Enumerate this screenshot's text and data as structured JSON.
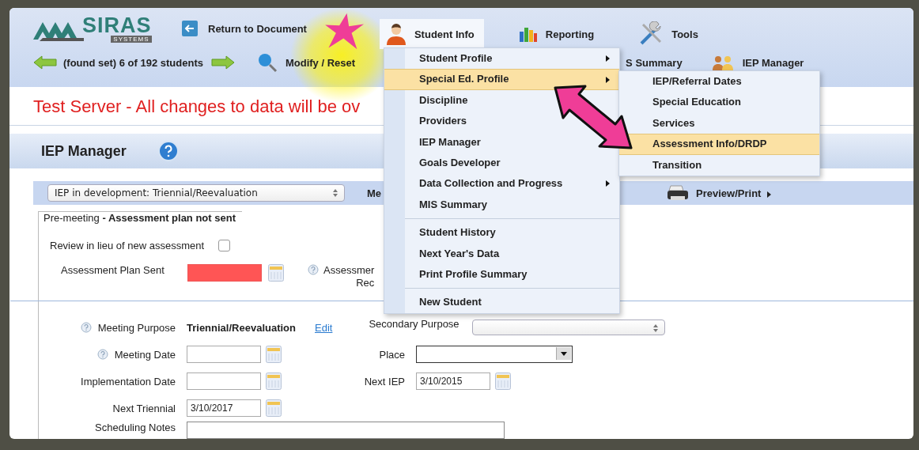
{
  "logo": {
    "name": "SIRAS",
    "tagline": "SYSTEMS"
  },
  "return_button": {
    "label": "Return to Document"
  },
  "nav_menus": [
    {
      "label": "Student Info",
      "selected": true
    },
    {
      "label": "Reporting",
      "selected": false
    },
    {
      "label": "Tools",
      "selected": false
    }
  ],
  "record_nav": {
    "text": "(found set) 6 of 192 students"
  },
  "toolbar_links": [
    {
      "label": "Modify / Reset"
    },
    {
      "label": "S Summary"
    },
    {
      "label": "IEP Manager"
    }
  ],
  "banner": "Test Server - All changes to data will be ov",
  "section_title": "IEP Manager",
  "iep_select": {
    "value": "IEP in development: Triennial/Reevaluation"
  },
  "toolbar_cut_label": "Me",
  "preview_print": {
    "label": "Preview/Print"
  },
  "fieldset_legend": "Pre-meeting **- Assessment plan not sent**",
  "review_checkbox": {
    "label": "Review in lieu of new assessment",
    "checked": false
  },
  "plan_sent": {
    "label": "Assessment Plan Sent",
    "error": true
  },
  "assessment_cut": {
    "line_1": "Assessmer",
    "line_2": "Rec"
  },
  "meeting_purpose": {
    "label": "Meeting Purpose",
    "value": "Triennial/Reevaluation",
    "edit": "Edit"
  },
  "secondary_purpose": {
    "label": "Secondary Purpose"
  },
  "date_rows": [
    {
      "label": "Meeting Date",
      "help": true,
      "side": {
        "label": "Place",
        "kind": "combo"
      }
    },
    {
      "label": "Implementation Date",
      "help": false,
      "side": {
        "label": "Next IEP",
        "kind": "date",
        "value": "3/10/2015"
      }
    },
    {
      "label": "Next Triennial",
      "help": false,
      "value": "3/10/2017"
    }
  ],
  "scheduling_notes": {
    "label": "Scheduling Notes"
  },
  "menu": {
    "groups": [
      [
        {
          "label": "Student Profile",
          "submenu": true,
          "selected": false
        },
        {
          "label": "Special Ed. Profile",
          "submenu": true,
          "selected": true
        },
        {
          "label": "Discipline",
          "submenu": false,
          "selected": false
        },
        {
          "label": "Providers",
          "submenu": false,
          "selected": false
        },
        {
          "label": "IEP Manager",
          "submenu": false,
          "selected": false
        },
        {
          "label": "Goals Developer",
          "submenu": false,
          "selected": false
        },
        {
          "label": "Data Collection and Progress",
          "submenu": true,
          "selected": false
        },
        {
          "label": "MIS Summary",
          "submenu": false,
          "selected": false
        }
      ],
      [
        {
          "label": "Student History",
          "submenu": false,
          "selected": false
        },
        {
          "label": "Next Year's Data",
          "submenu": false,
          "selected": false
        },
        {
          "label": "Print Profile Summary",
          "submenu": false,
          "selected": false
        }
      ],
      [
        {
          "label": "New Student",
          "submenu": false,
          "selected": false
        }
      ]
    ]
  },
  "submenu": {
    "items": [
      {
        "label": "IEP/Referral Dates",
        "selected": false
      },
      {
        "label": "Special Education",
        "selected": false
      },
      {
        "label": "Services",
        "selected": false
      },
      {
        "label": "Assessment Info/DRDP",
        "selected": true
      },
      {
        "label": "Transition",
        "selected": false
      }
    ]
  }
}
